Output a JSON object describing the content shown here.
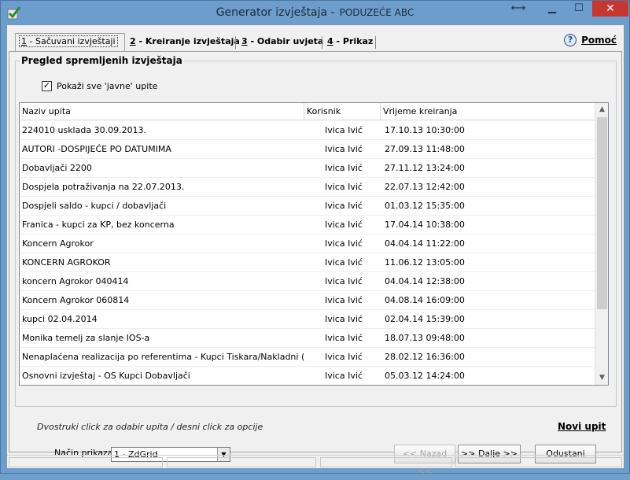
{
  "window": {
    "title": "Generator izvještaja -",
    "company": "PODUZEĆE ABC",
    "controls": [
      "restore",
      "minimize",
      "maximize",
      "close"
    ]
  },
  "tabs": [
    {
      "number": "1",
      "label": "- Sačuvani izvještaji"
    },
    {
      "number": "2",
      "label": "- Kreiranje izvještaja"
    },
    {
      "number": "3",
      "label": "- Odabir uvjeta"
    },
    {
      "number": "4",
      "label": "- Prikaz"
    }
  ],
  "help": {
    "label": "Pomoć"
  },
  "group": {
    "title": "Pregled spremljenih izvještaja",
    "checkbox_label": "Pokaži sve 'javne' upite",
    "checked": true
  },
  "grid": {
    "columns": [
      "Naziv upita",
      "Korisnik",
      "Vrijeme kreiranja"
    ],
    "rows": [
      [
        "224010 usklada 30.09.2013.",
        "Ivica Ivić",
        "17.10.13 10:30:00"
      ],
      [
        "AUTORI -DOSPIJEĆE PO DATUMIMA",
        "Ivica Ivić",
        "27.09.13 11:48:00"
      ],
      [
        "Dobavljači 2200",
        "Ivica Ivić",
        "27.11.12 13:24:00"
      ],
      [
        "Dospjela potraživanja na 22.07.2013.",
        "Ivica Ivić",
        "22.07.13 12:42:00"
      ],
      [
        "Dospjeli saldo - kupci / dobavljači",
        "Ivica Ivić",
        "01.03.12 15:35:00"
      ],
      [
        "Franica - kupci za KP, bez koncerna",
        "Ivica Ivić",
        "17.04.14 10:38:00"
      ],
      [
        "Koncern Agrokor",
        "Ivica Ivić",
        "04.04.14 11:22:00"
      ],
      [
        "KONCERN AGROKOR",
        "Ivica Ivić",
        "11.06.12 13:05:00"
      ],
      [
        "koncern Agrokor 040414",
        "Ivica Ivić",
        "04.04.14 12:38:00"
      ],
      [
        "Koncern Agrokor 060814",
        "Ivica Ivić",
        "04.08.14 16:09:00"
      ],
      [
        "kupci 02.04.2014",
        "Ivica Ivić",
        "02.04.14 15:39:00"
      ],
      [
        "Monika temelj za slanje IOS-a",
        "Ivica Ivić",
        "18.07.13 09:48:00"
      ],
      [
        "Nenaplaćena realizacija po referentima - Kupci Tiskara/Nakladni (Grafičar)",
        "Ivica Ivić",
        "28.02.12 16:36:00"
      ],
      [
        "Osnovni izvještaj  - OS Kupci Dobavljači",
        "Ivica Ivić",
        "05.03.12 14:24:00"
      ]
    ]
  },
  "hint": "Dvostruki click za odabir upita / desni click za opcije",
  "new_link": "Novi upit",
  "display": {
    "label": "Način prikaza",
    "value": "1 - ZdGrid"
  },
  "buttons": {
    "back": "<< Nazad <<",
    "next": ">> Dalje >>",
    "cancel": "Odustani"
  }
}
